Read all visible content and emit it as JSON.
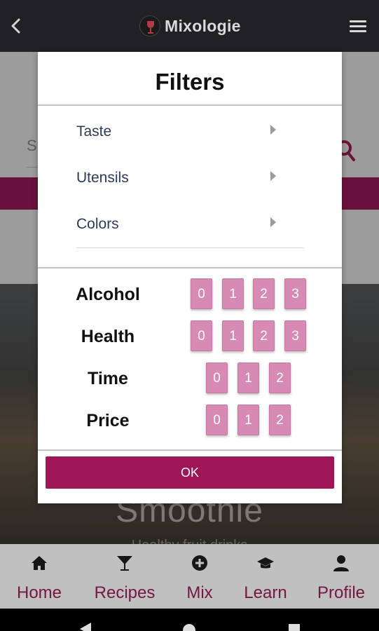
{
  "app": {
    "title": "Mixologie"
  },
  "background": {
    "search_placeholder": "S",
    "hero_title": "Smoothie",
    "hero_subtitle": "Healthy fruit drinks"
  },
  "dialog": {
    "title": "Filters",
    "links": [
      {
        "label": "Taste"
      },
      {
        "label": "Utensils"
      },
      {
        "label": "Colors"
      }
    ],
    "levels": [
      {
        "label": "Alcohol",
        "options": [
          "0",
          "1",
          "2",
          "3"
        ]
      },
      {
        "label": "Health",
        "options": [
          "0",
          "1",
          "2",
          "3"
        ]
      },
      {
        "label": "Time",
        "options": [
          "0",
          "1",
          "2"
        ]
      },
      {
        "label": "Price",
        "options": [
          "0",
          "1",
          "2"
        ]
      }
    ],
    "ok_label": "OK"
  },
  "bottom_nav": [
    {
      "label": "Home",
      "icon": "home-icon"
    },
    {
      "label": "Recipes",
      "icon": "cocktail-glass-icon"
    },
    {
      "label": "Mix",
      "icon": "plus-circle-icon"
    },
    {
      "label": "Learn",
      "icon": "graduation-cap-icon"
    },
    {
      "label": "Profile",
      "icon": "user-icon"
    }
  ],
  "colors": {
    "accent": "#9e1558",
    "chip": "#d78ab4",
    "nav_label": "#8e1d55",
    "appbar": "#212125"
  }
}
